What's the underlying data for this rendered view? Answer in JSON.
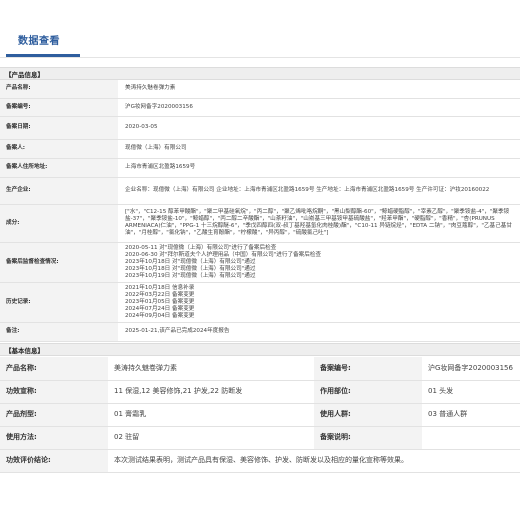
{
  "tab": {
    "label": "数据查看"
  },
  "product_section": {
    "title": "【产品信息】",
    "rows": [
      {
        "key": "产品名称:",
        "value": "美涛持久魅卷弹力素"
      },
      {
        "key": "备案编号:",
        "value": "沪G妆网备字2020003156"
      },
      {
        "key": "备案日期:",
        "value": "2020-03-05"
      },
      {
        "key": "备案人:",
        "value": "现億微（上海）有限公司"
      },
      {
        "key": "备案人住所地址:",
        "value": "上海市青浦区北盈路1659号"
      },
      {
        "key": "生产企业:",
        "value": "企业名称：现億微（上海）有限公司 企业地址：上海市青浦区北盈路1659号 生产地址：上海市青浦区北盈路1659号 生产许可证：沪妆20160022"
      },
      {
        "key": "成分:",
        "value": "[\"水\"，\"C12-15 醇苯甲酸酯\"，\"聚二甲基硅氧烷\"，\"丙二醇\"，\"聚乙烯吡咯烷酮\"，\"黑山梨醇酯-60\"，\"鲸蜡硬脂醇\"，\"宰素乙醇\"，\"聚季铵盐-4\"，\"聚季铵盐-37\"，\"聚季铵盐-10\"，\"鲸蜡醇\"，\"丙二醇二辛酸酯\"，\"山茶籽油\"，\"山嵛基三甲基铵甲基硫酸盐\"，\"羟苯甲酯\"，\"硬脂醇\"，\"香精\"，\"杏(PRUNUS ARMENIACA)仁油\"，\"PPG-1 十三烷醇醚-6\"，\"季戊四醇四(双-叔丁基羟基氢化肉桂酸)酯\"，\"C10-11 异链烷烃\"，\"EDTA 二钠\"，\"肉豆蔻醇\"，\"乙基己基甘油\"，\"月桂醇\"，\"氯化钠\"，\"乙酸生育酚酯\"，\"柠檬酸\"，\"异丙醇\"，\"硫酸氯己吐\"]"
      },
      {
        "key": "备案后监督检查情况:",
        "value": "2020-05-11 对\"现億微（上海）有限公司\"进行了备案后检查\n2020-06-30 对\"拜尔斯道夫个人护理用品（中国）有限公司\"进行了备案后检查\n2023年10月18日 对\"现億微（上海）有限公司\"通过\n2023年10月18日 对\"现億微（上海）有限公司\"通过\n2023年10月19日 对\"现億微（上海）有限公司\"通过"
      },
      {
        "key": "历史记录:",
        "value": "2021年10月18日 信息补录\n2022年03月22日 备案变更\n2023年01月05日 备案变更\n2024年07月24日 备案变更\n2024年09月04日 备案变更"
      },
      {
        "key": "备注:",
        "value": "2025-01-21,该产品已完成2024年度报告"
      }
    ]
  },
  "basic_section": {
    "title": "【基本信息】",
    "rows": [
      {
        "k1": "产品名称:",
        "v1": "美涛持久魅卷弹力素",
        "k2": "备案编号:",
        "v2": "沪G妆网备字2020003156"
      },
      {
        "k1": "功效宣称:",
        "v1": "11 保湿,12 美容修饰,21 护发,22 防断发",
        "k2": "作用部位:",
        "v2": "01 头发"
      },
      {
        "k1": "产品剂型:",
        "v1": "01 膏霜乳",
        "k2": "使用人群:",
        "v2": "03 普通人群"
      },
      {
        "k1": "使用方法:",
        "v1": "02 驻留",
        "k2": "备案说明:",
        "v2": ""
      }
    ],
    "eval": {
      "key": "功效评价结论:",
      "value": "本次测试结果表明，测试产品具有保湿、美容修饰、护发、防断发以及相应的量化宣称等效果。"
    }
  }
}
